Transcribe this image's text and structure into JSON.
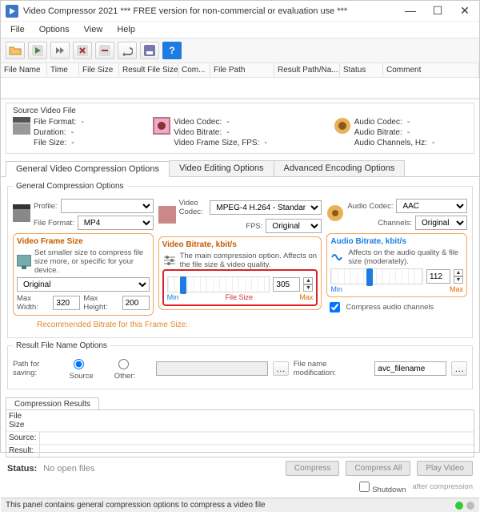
{
  "window": {
    "title": "Video Compressor 2021    *** FREE version for non-commercial or evaluation use ***"
  },
  "menu": [
    "File",
    "Options",
    "View",
    "Help"
  ],
  "columns": {
    "c0": "File Name",
    "c1": "Time",
    "c2": "File Size",
    "c3": "Result File Size",
    "c4": "Com...",
    "c5": "File Path",
    "c6": "Result Path/Na...",
    "c7": "Status",
    "c8": "Comment"
  },
  "source": {
    "title": "Source Video File",
    "ff_label": "File Format:",
    "ff": "-",
    "dur_label": "Duration:",
    "dur": "-",
    "fs_label": "File Size:",
    "fs": "-",
    "vc_label": "Video Codec:",
    "vc": "-",
    "vb_label": "Video Bitrate:",
    "vb": "-",
    "vfs_label": "Video Frame Size, FPS:",
    "vfs": "-",
    "ac_label": "Audio Codec:",
    "ac": "-",
    "ab_label": "Audio Bitrate:",
    "ab": "-",
    "ach_label": "Audio Channels, Hz:",
    "ach": "-"
  },
  "tabs": {
    "t0": "General Video Compression Options",
    "t1": "Video Editing Options",
    "t2": "Advanced Encoding Options"
  },
  "opts": {
    "gco_legend": "General Compression Options",
    "profile_label": "Profile:",
    "fileformat_label": "File Format:",
    "fileformat_value": "MP4",
    "vcodec_label": "Video Codec:",
    "vcodec_value": "MPEG-4 H.264 - Standar",
    "fps_label": "FPS:",
    "fps_value": "Original",
    "acodec_label": "Audio Codec:",
    "acodec_value": "AAC",
    "channels_label": "Channels:",
    "channels_value": "Original",
    "vfs_title": "Video Frame Size",
    "vfs_desc": "Set smaller size to compress file size more, or specific for your device.",
    "vfs_select": "Original",
    "maxw_label": "Max Width:",
    "maxw": "320",
    "maxh_label": "Max Height:",
    "maxh": "200",
    "rec_label": "Recommended Bitrate for this Frame Size:",
    "vbr_title": "Video Bitrate, kbit/s",
    "vbr_desc": "The main compression option. Affects on the file size & video quality.",
    "vbr_value": "305",
    "abr_title": "Audio Bitrate, kbit/s",
    "abr_desc": "Affects on the audio quality & file size (moderately).",
    "abr_value": "112",
    "compress_audio": "Compress audio channels",
    "min": "Min",
    "max": "Max",
    "filesize": "File Size"
  },
  "result": {
    "legend": "Result File Name Options",
    "path_label": "Path for saving:",
    "source_radio": "Source",
    "other_radio": "Other:",
    "fnm_label": "File name modification:",
    "fnm_value": "avc_filename"
  },
  "results_area": {
    "tab": "Compression Results",
    "fs_label": "File Size",
    "src_label": "Source:",
    "res_label": "Result:"
  },
  "footer": {
    "status_label": "Status:",
    "status_value": "No open files",
    "compress": "Compress",
    "compress_all": "Compress All",
    "play": "Play Video",
    "shutdown": "Shutdown",
    "after": "after compression"
  },
  "statusbar": {
    "text": "This panel contains general compression options to compress a video file"
  }
}
